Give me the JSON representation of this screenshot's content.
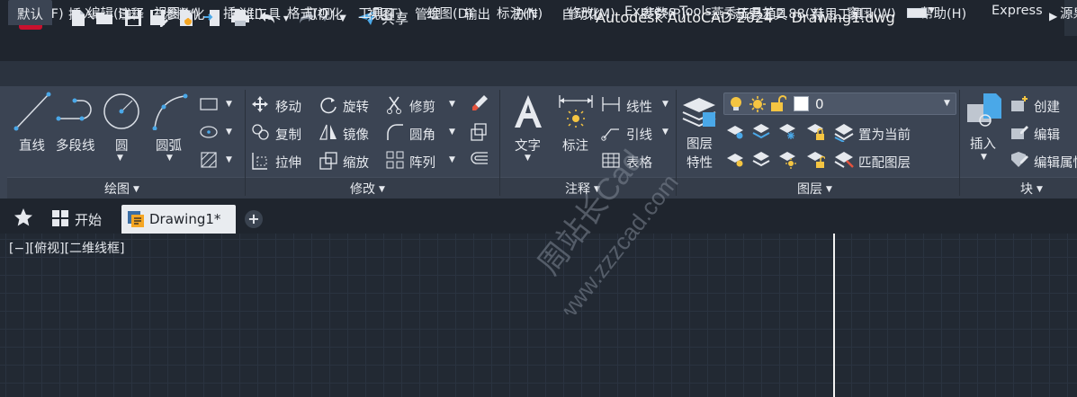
{
  "app": {
    "logo_letter": "A",
    "title": "Autodesk AutoCAD 2024    Drawing1.dwg",
    "share_label": "共享"
  },
  "quick_access": [
    "new-icon",
    "open-icon",
    "save-icon",
    "save-as-icon",
    "open-from-web-icon",
    "publish-icon",
    "plot-icon",
    "undo-icon",
    "redo-icon",
    "workspace-dropdown-icon",
    "share-icon"
  ],
  "menubar": [
    "文件(F)",
    "编辑(E)",
    "视图(V)",
    "插入(I)",
    "格式(O)",
    "工具(T)",
    "绘图(D)",
    "标注(N)",
    "修改(M)",
    "参数(P)",
    "燕秀工具箱2.88(Y)",
    "窗口(W)",
    "帮助(H)",
    "Express",
    "源泉"
  ],
  "ribbon_tabs": [
    "默认",
    "插入",
    "注释",
    "参数化",
    "三维工具",
    "可视化",
    "视图",
    "管理",
    "输出",
    "协作",
    "自动化",
    "Express Tools",
    "赫思工具",
    "赫思工具*"
  ],
  "active_tab": "默认",
  "panels": {
    "draw": {
      "title": "绘图",
      "tools": [
        "直线",
        "多段线",
        "圆",
        "圆弧"
      ]
    },
    "modify": {
      "title": "修改",
      "tools": [
        "移动",
        "旋转",
        "修剪",
        "复制",
        "镜像",
        "圆角",
        "拉伸",
        "缩放",
        "阵列"
      ]
    },
    "annotation": {
      "title": "注释",
      "tools": [
        "文字",
        "标注",
        "线性",
        "引线",
        "表格"
      ]
    },
    "layers": {
      "title": "图层",
      "properties_label_1": "图层",
      "properties_label_2": "特性",
      "current_layer": "0",
      "tools": [
        "置为当前",
        "匹配图层"
      ]
    },
    "block": {
      "title": "块",
      "insert_label": "插入",
      "tools": [
        "创建",
        "编辑",
        "编辑属性"
      ]
    }
  },
  "file_tabs": {
    "start_label": "开始",
    "document_label": "Drawing1*"
  },
  "viewport": {
    "label": "[−][俯视][二维线框]"
  },
  "watermark": {
    "line1": "周站长Cad",
    "line2": "www.zzzcad.com"
  },
  "colors": {
    "app_logo": "#c8102e",
    "ribbon_bg": "#3b4453",
    "canvas_bg": "#222933",
    "accent_blue": "#4aa8e8"
  }
}
